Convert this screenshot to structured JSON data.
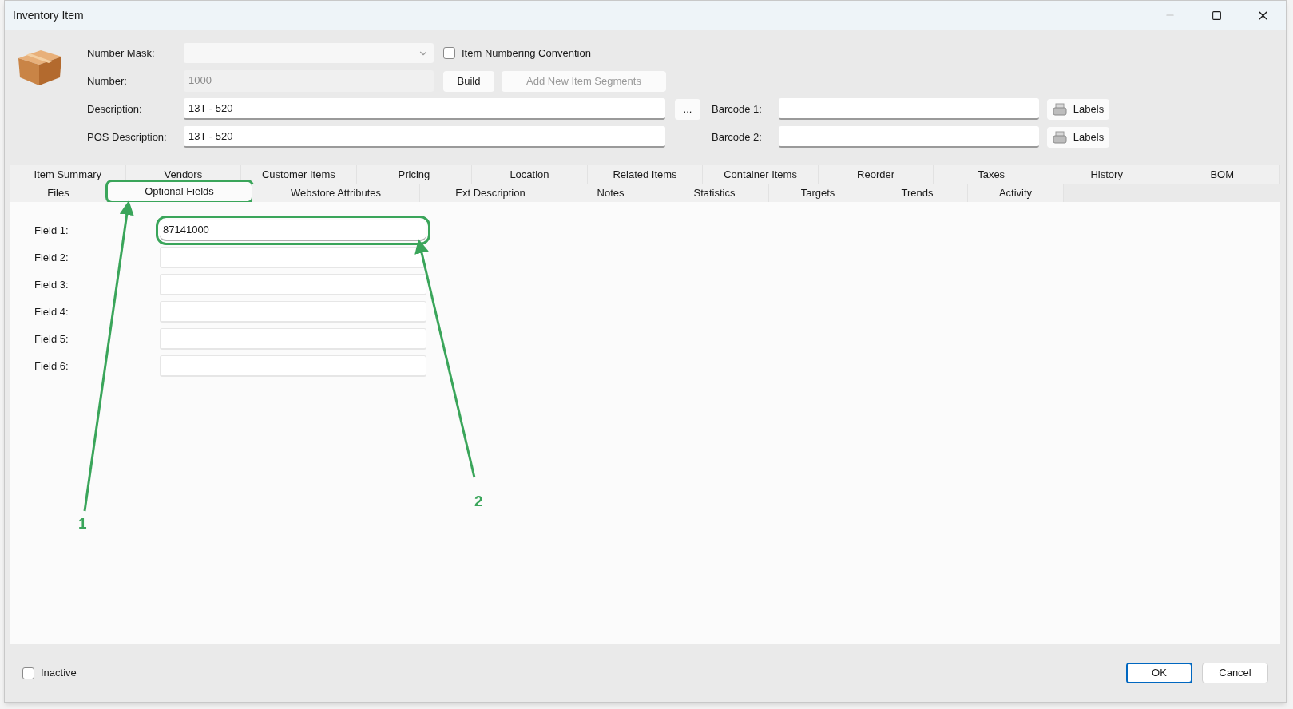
{
  "window": {
    "title": "Inventory Item"
  },
  "header": {
    "number_mask": {
      "label": "Number Mask:"
    },
    "item_numbering_convention": {
      "label": "Item Numbering Convention",
      "checked": false
    },
    "number": {
      "label": "Number:",
      "value": "1000",
      "disabled": true
    },
    "build_button": {
      "label": "Build",
      "disabled": false
    },
    "add_segments_button": {
      "label": "Add New Item Segments",
      "disabled": true
    },
    "description": {
      "label": "Description:",
      "value": "13T - 520"
    },
    "more_button": {
      "label": "..."
    },
    "pos_description": {
      "label": "POS Description:",
      "value": "13T - 520"
    },
    "barcodes": [
      {
        "label": "Barcode 1:",
        "button": "Labels"
      },
      {
        "label": "Barcode 2:",
        "button": "Labels"
      }
    ]
  },
  "tab_rows": [
    [
      {
        "label": "Item Summary",
        "selected": false,
        "highlighted": false
      },
      {
        "label": "Vendors",
        "selected": false,
        "highlighted": false
      },
      {
        "label": "Customer Items",
        "selected": false,
        "highlighted": false
      },
      {
        "label": "Pricing",
        "selected": false,
        "highlighted": false
      },
      {
        "label": "Location",
        "selected": false,
        "highlighted": false
      },
      {
        "label": "Related Items",
        "selected": false,
        "highlighted": false
      },
      {
        "label": "Container Items",
        "selected": false,
        "highlighted": false
      },
      {
        "label": "Reorder",
        "selected": false,
        "highlighted": false
      },
      {
        "label": "Taxes",
        "selected": false,
        "highlighted": false
      },
      {
        "label": "History",
        "selected": false,
        "highlighted": false
      },
      {
        "label": "BOM",
        "selected": false,
        "highlighted": false
      }
    ],
    [
      {
        "label": "Files",
        "selected": false,
        "highlighted": false
      },
      {
        "label": "Optional Fields",
        "selected": true,
        "highlighted": true
      },
      {
        "label": "Webstore Attributes",
        "selected": false,
        "highlighted": false
      },
      {
        "label": "Ext Description",
        "selected": false,
        "highlighted": false
      },
      {
        "label": "Notes",
        "selected": false,
        "highlighted": false
      },
      {
        "label": "Statistics",
        "selected": false,
        "highlighted": false
      },
      {
        "label": "Targets",
        "selected": false,
        "highlighted": false
      },
      {
        "label": "Trends",
        "selected": false,
        "highlighted": false
      },
      {
        "label": "Activity",
        "selected": false,
        "highlighted": false
      }
    ]
  ],
  "fields": [
    {
      "label": "Field 1:",
      "value": "87141000",
      "highlighted": true
    },
    {
      "label": "Field 2:",
      "highlighted": false
    },
    {
      "label": "Field 3:",
      "highlighted": false
    },
    {
      "label": "Field 4:",
      "highlighted": false
    },
    {
      "label": "Field 5:",
      "highlighted": false
    },
    {
      "label": "Field 6:",
      "highlighted": false
    }
  ],
  "footer": {
    "inactive": {
      "label": "Inactive",
      "checked": false
    },
    "buttons": [
      {
        "label": "OK",
        "default": true
      },
      {
        "label": "Cancel",
        "default": false
      }
    ]
  },
  "callouts": [
    {
      "label": "1"
    },
    {
      "label": "2"
    }
  ]
}
